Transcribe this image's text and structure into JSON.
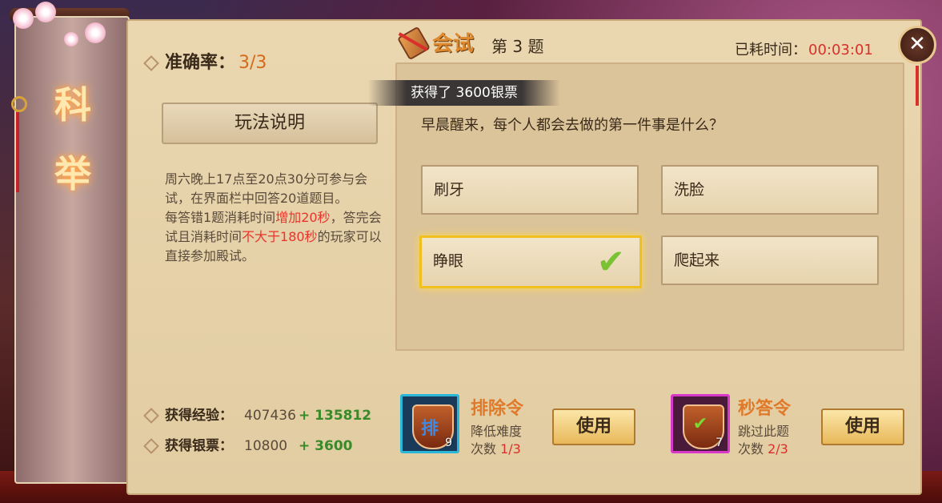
{
  "side": {
    "title_chars": [
      "科",
      "举"
    ]
  },
  "accuracy": {
    "label": "准确率：",
    "value": "3/3"
  },
  "rules_button": "玩法说明",
  "rules": {
    "p1": "周六晚上17点至20点30分可参与会试，在界面栏中回答20道题目。",
    "p2a": "每答错1题消耗时间",
    "p2b": "增加20秒",
    "p2c": "，答完会试且消耗时间",
    "p2d": "不大于180秒",
    "p2e": "的玩家可以直接参加殿试。"
  },
  "stats": {
    "exp_label": "获得经验：",
    "exp_value": "407436",
    "exp_gain": "+ 135812",
    "silver_label": "获得银票：",
    "silver_value": "10800",
    "silver_gain": "+ 3600"
  },
  "header": {
    "title": "会试",
    "question_number": "第 3 题",
    "elapsed_label": "已耗时间：",
    "elapsed_value": "00:03:01"
  },
  "toast": "获得了 3600银票",
  "question": "早晨醒来，每个人都会去做的第一件事是什么？",
  "options": [
    {
      "label": "刷牙",
      "selected": false
    },
    {
      "label": "洗脸",
      "selected": false
    },
    {
      "label": "睁眼",
      "selected": true
    },
    {
      "label": "爬起来",
      "selected": false
    }
  ],
  "items": [
    {
      "name": "排除令",
      "icon_glyph": "排",
      "count": "9",
      "desc": "降低难度",
      "uses_label": "次数",
      "uses": "1/3",
      "button": "使用",
      "frame_color": "#2ab6d8"
    },
    {
      "name": "秒答令",
      "icon_glyph": "✔",
      "count": "7",
      "desc": "跳过此题",
      "uses_label": "次数",
      "uses": "2/3",
      "button": "使用",
      "frame_color": "#d838c8"
    }
  ],
  "colors": {
    "accent": "#e07a2a",
    "positive": "#3a8a2a",
    "warning": "#d8302a"
  }
}
